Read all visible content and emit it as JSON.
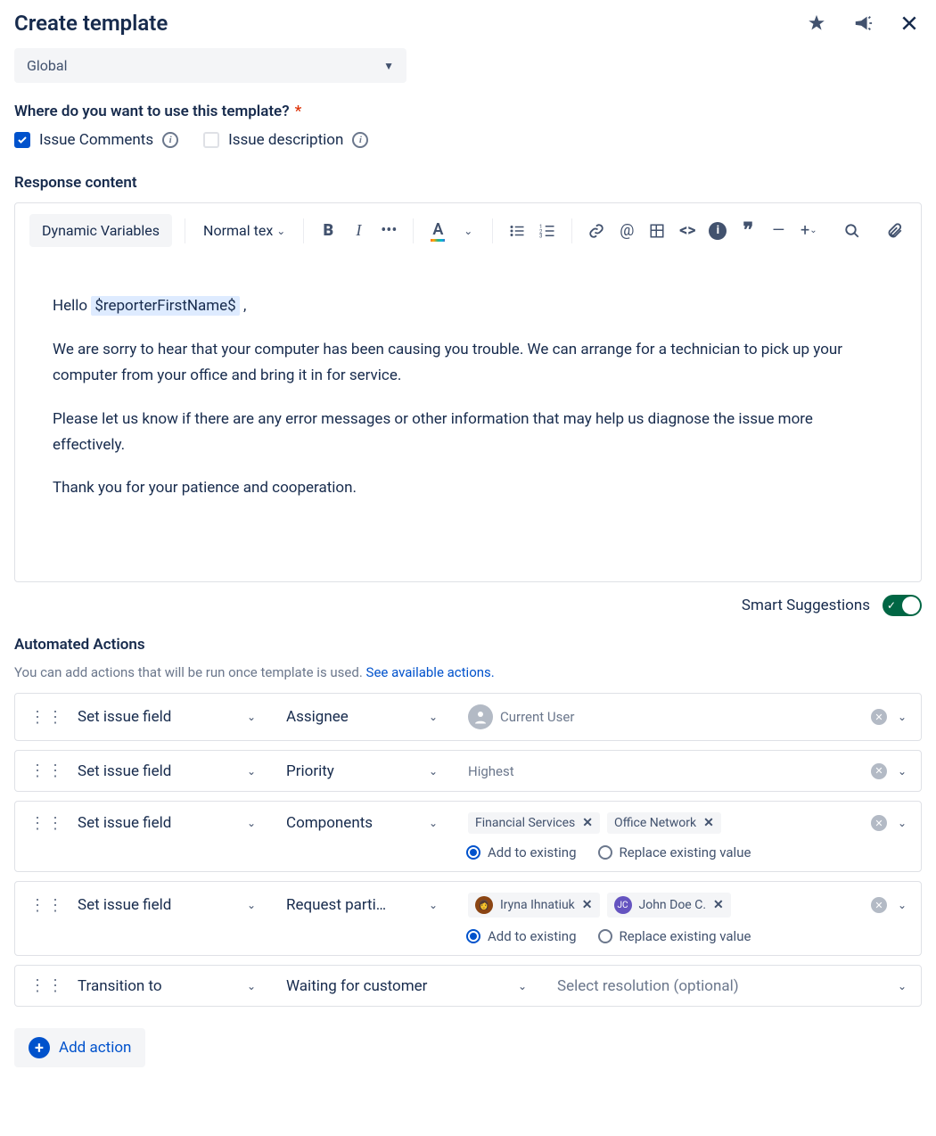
{
  "header": {
    "title": "Create template"
  },
  "scope": {
    "selected": "Global"
  },
  "usage": {
    "label": "Where do you want to use this template?",
    "options": [
      {
        "label": "Issue Comments",
        "checked": true
      },
      {
        "label": "Issue description",
        "checked": false
      }
    ]
  },
  "content": {
    "label": "Response content",
    "toolbar": {
      "dynvars": "Dynamic Variables",
      "textstyle": "Normal tex"
    },
    "body": {
      "greeting": "Hello",
      "variable": "$reporterFirstName$",
      "comma": ",",
      "p1": "We are sorry to hear that your computer has been causing you trouble. We can arrange for a technician to pick up your computer from your office and bring it in for service.",
      "p2": "Please let us know if there are any error messages or other information that may help us diagnose the issue more effectively.",
      "p3": "Thank you for your patience and cooperation."
    }
  },
  "smart": {
    "label": "Smart Suggestions",
    "enabled": true
  },
  "actionsSection": {
    "title": "Automated Actions",
    "subtitle": "You can add actions that will be run once template is used.",
    "link": "See available actions."
  },
  "actions": [
    {
      "type": "Set issue field",
      "field": "Assignee",
      "valueLabel": "Current User"
    },
    {
      "type": "Set issue field",
      "field": "Priority",
      "valueLabel": "Highest"
    },
    {
      "type": "Set issue field",
      "field": "Components",
      "tags": [
        "Financial Services",
        "Office Network"
      ],
      "mode": "add"
    },
    {
      "type": "Set issue field",
      "field": "Request parti…",
      "participants": [
        {
          "name": "Iryna Ihnatiuk",
          "color": "#8B4513"
        },
        {
          "name": "John Doe C.",
          "color": "#6554C0",
          "initials": "JC"
        }
      ],
      "mode": "add"
    }
  ],
  "modes": {
    "add": "Add to existing",
    "replace": "Replace existing value"
  },
  "transition": {
    "type": "Transition to",
    "status": "Waiting for customer",
    "resolutionPlaceholder": "Select resolution (optional)"
  },
  "addAction": "Add action"
}
